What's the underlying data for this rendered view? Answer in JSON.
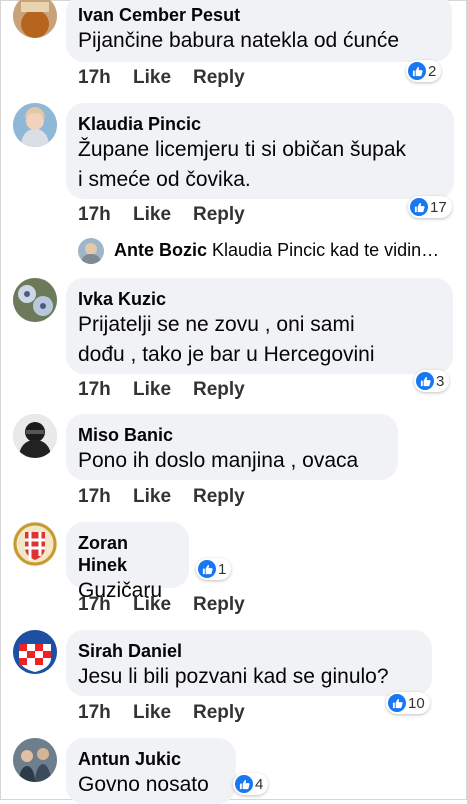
{
  "comments": [
    {
      "author": "Ivan Cember Pesut",
      "lines": [
        "Pijančine babura natekla od ćunće"
      ],
      "time": "17h",
      "like": "Like",
      "reply": "Reply",
      "reactions": "2"
    },
    {
      "author": "Klaudia Pincic",
      "lines": [
        "Župane licemjeru ti si običan šupak",
        "i smeće od čovika."
      ],
      "time": "17h",
      "like": "Like",
      "reply": "Reply",
      "reactions": "17"
    },
    {
      "author": "Ivka Kuzic",
      "lines": [
        "Prijatelji se ne zovu , oni sami",
        "dođu , tako je bar u Hercegovini"
      ],
      "time": "17h",
      "like": "Like",
      "reply": "Reply",
      "reactions": "3"
    },
    {
      "author": "Miso Banic",
      "lines": [
        "Pono ih doslo manjina , ovaca"
      ],
      "time": "17h",
      "like": "Like",
      "reply": "Reply",
      "reactions": ""
    },
    {
      "author": "Zoran Hinek",
      "lines": [
        "Guzičaru"
      ],
      "time": "17h",
      "like": "Like",
      "reply": "Reply",
      "reactions": "1"
    },
    {
      "author": "Sirah Daniel",
      "lines": [
        "Jesu li bili pozvani kad se ginulo?"
      ],
      "time": "17h",
      "like": "Like",
      "reply": "Reply",
      "reactions": "10"
    },
    {
      "author": "Antun Jukic",
      "lines": [
        "Govno nosato"
      ],
      "time": "",
      "like": "",
      "reply": "",
      "reactions": "4"
    }
  ],
  "reply_preview": {
    "author": "Ante Bozic",
    "text": "Klaudia Pincic kad te vidin…"
  },
  "colors": {
    "bubble": "#f0f2f5",
    "like_blue": "#1877f2",
    "text": "#050505"
  }
}
